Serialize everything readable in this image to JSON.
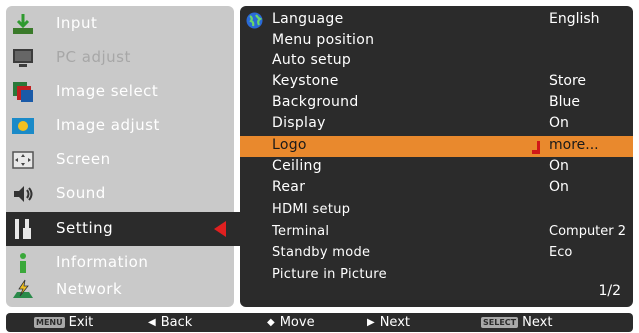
{
  "left_menu": {
    "items": [
      {
        "label": "Input",
        "icon": "input-icon",
        "dim": false
      },
      {
        "label": "PC adjust",
        "icon": "pc-adjust-icon",
        "dim": true
      },
      {
        "label": "Image select",
        "icon": "image-select-icon",
        "dim": false
      },
      {
        "label": "Image adjust",
        "icon": "image-adjust-icon",
        "dim": false
      },
      {
        "label": "Screen",
        "icon": "screen-icon",
        "dim": false
      },
      {
        "label": "Sound",
        "icon": "sound-icon",
        "dim": false
      },
      {
        "label": "Setting",
        "icon": "setting-icon",
        "dim": false,
        "active": true
      },
      {
        "label": "Information",
        "icon": "information-icon",
        "dim": false
      },
      {
        "label": "Network",
        "icon": "network-icon",
        "dim": false
      }
    ]
  },
  "settings": {
    "rows": [
      {
        "label": "Language",
        "value": "English"
      },
      {
        "label": "Menu position",
        "value": ""
      },
      {
        "label": "Auto setup",
        "value": ""
      },
      {
        "label": "Keystone",
        "value": "Store"
      },
      {
        "label": "Background",
        "value": "Blue"
      },
      {
        "label": "Display",
        "value": "On"
      },
      {
        "label": "Logo",
        "value": "more...",
        "highlight": true
      },
      {
        "label": "Ceiling",
        "value": "On"
      },
      {
        "label": "Rear",
        "value": "On"
      },
      {
        "label": "HDMI setup",
        "value": ""
      },
      {
        "label": "Terminal",
        "value": "Computer 2"
      },
      {
        "label": "Standby mode",
        "value": "Eco"
      },
      {
        "label": "Picture in Picture",
        "value": ""
      }
    ],
    "page": "1/2"
  },
  "bottom_bar": {
    "exit_key": "MENU",
    "exit_label": "Exit",
    "back_label": "Back",
    "move_label": "Move",
    "next_label": "Next",
    "select_key": "SELECT",
    "select_next_label": "Next"
  },
  "colors": {
    "panel_dark": "#2b2b2b",
    "panel_light": "#c9c9c9",
    "highlight": "#e9892d",
    "pointer": "#e02020"
  }
}
